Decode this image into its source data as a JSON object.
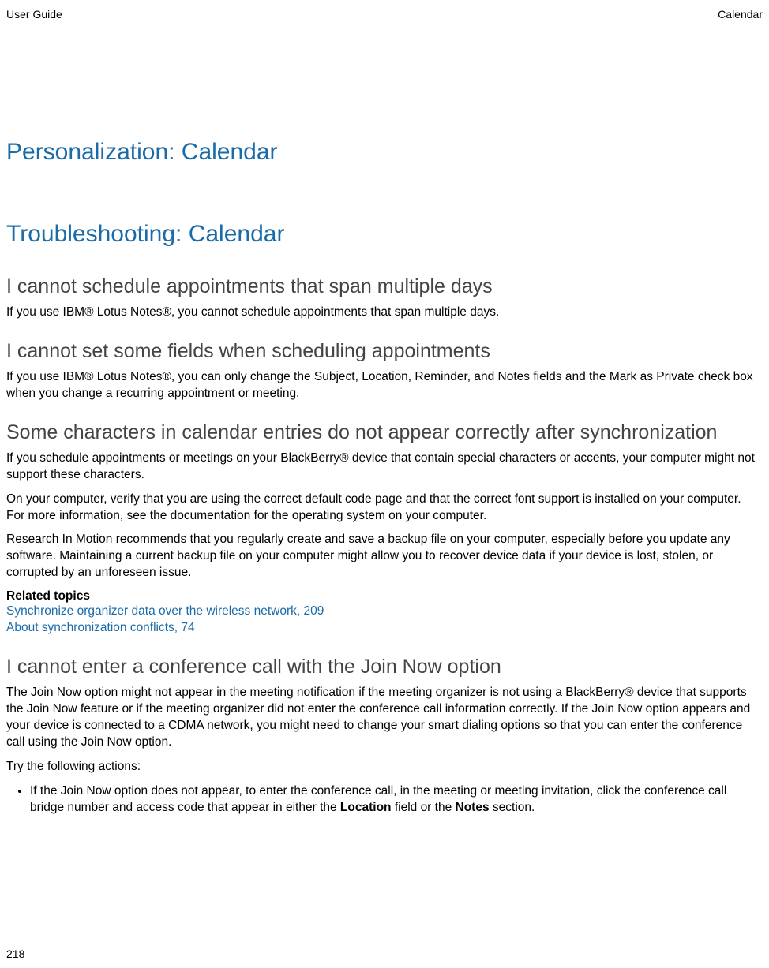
{
  "header": {
    "left": "User Guide",
    "right": "Calendar"
  },
  "h1": "Personalization: Calendar",
  "h2": "Troubleshooting: Calendar",
  "section1": {
    "heading": "I cannot schedule appointments that span multiple days",
    "p1": "If you use IBM® Lotus Notes®, you cannot schedule appointments that span multiple days."
  },
  "section2": {
    "heading": "I cannot set some fields when scheduling appointments",
    "p1": "If you use IBM® Lotus Notes®, you can only change the Subject, Location, Reminder, and Notes fields and the Mark as Private check box when you change a recurring appointment or meeting."
  },
  "section3": {
    "heading": "Some characters in calendar entries do not appear correctly after synchronization",
    "p1": "If you schedule appointments or meetings on your BlackBerry® device that contain special characters or accents, your computer might not support these characters.",
    "p2": "On your computer, verify that you are using the correct default code page and that the correct font support is installed on your computer. For more information, see the documentation for the operating system on your computer.",
    "p3": "Research In Motion recommends that you regularly create and save a backup file on your computer, especially before you update any software. Maintaining a current backup file on your computer might allow you to recover device data if your device is lost, stolen, or corrupted by an unforeseen issue.",
    "related_heading": "Related topics",
    "link1": "Synchronize organizer data over the wireless network, 209",
    "link2": "About synchronization conflicts, 74"
  },
  "section4": {
    "heading": "I cannot enter a conference call with the Join Now option",
    "p1": "The Join Now option might not appear in the meeting notification if the meeting organizer is not using a BlackBerry® device that supports the Join Now feature or if the meeting organizer did not enter the conference call information correctly. If the Join Now option appears and your device is connected to a CDMA network, you might need to change your smart dialing options so that you can enter the conference call using the Join Now option.",
    "p2": "Try the following actions:",
    "bullet1_before": "If the Join Now option does not appear, to enter the conference call, in the meeting or meeting invitation, click the conference call bridge number and access code that appear in either the ",
    "bullet1_bold1": "Location",
    "bullet1_mid": " field or the ",
    "bullet1_bold2": "Notes",
    "bullet1_after": " section."
  },
  "page_number": "218"
}
